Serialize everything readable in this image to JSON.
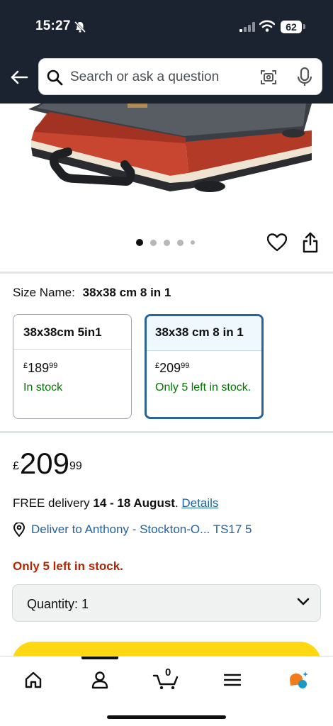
{
  "status_bar": {
    "time": "15:27",
    "battery": "62"
  },
  "search": {
    "placeholder": "Search or ask a question"
  },
  "gallery": {
    "image_count": 5,
    "active_index": 0
  },
  "size": {
    "label": "Size Name:",
    "selected": "38x38 cm 8 in 1",
    "options": [
      {
        "title": "38x38cm 5in1",
        "currency": "£",
        "whole": "189",
        "fraction": "99",
        "stock": "In stock",
        "selected": false
      },
      {
        "title": "38x38 cm 8 in 1",
        "currency": "£",
        "whole": "209",
        "fraction": "99",
        "stock": "Only 5 left in stock.",
        "selected": true
      }
    ]
  },
  "price": {
    "currency": "£",
    "whole": "209",
    "fraction": "99"
  },
  "delivery": {
    "prefix": "FREE delivery ",
    "dates": "14 - 18 August",
    "suffix": ". ",
    "details_link": "Details"
  },
  "deliver_to": {
    "text": "Deliver to Anthony - Stockton-O... TS17 5"
  },
  "stock_warning": "Only 5 left in stock.",
  "quantity": {
    "label": "Quantity: 1"
  },
  "tab_bar": {
    "active_tab": "account",
    "cart_count": "0",
    "tabs": [
      "home-icon",
      "account-icon",
      "cart-icon",
      "menu-icon",
      "assistant-icon"
    ]
  },
  "colors": {
    "header_bg": "#1b2330",
    "link": "#2162a1",
    "in_stock": "#007600",
    "warning": "#b12704",
    "buy_button": "#ffd814",
    "selected_border": "#2a6496"
  }
}
